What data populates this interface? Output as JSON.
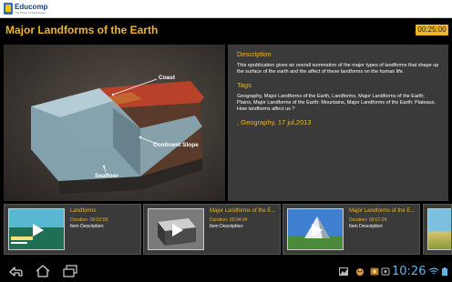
{
  "app": {
    "name": "Educomp",
    "tagline": "The Power of Technology"
  },
  "header": {
    "title": "Major Landforms of the Earth",
    "timer": "00:25:00"
  },
  "figure": {
    "labels": {
      "coast": "Coast",
      "continent_slope": "Continent Slope",
      "seafloor": "Seafloor"
    }
  },
  "details": {
    "description_heading": "Description",
    "description_text": "This epublication gives an overall summation of the major types of landforms that shape up the surface of the earth and the affect of these landforms on the human life.",
    "tags_heading": "Tags",
    "tags_text": "Geography, Major Landforms of the Earth, Landforms, Major Landforms of the Earth: Plains, Major Landforms of the Earth: Mountains, Major Landforms of the Earth: Plateaus, How landforms affect us ?",
    "meta": ", Geography, 17 jul,2013"
  },
  "related": [
    {
      "title": "Landforms",
      "duration_label": "Duration-",
      "duration": "00:02:59",
      "desc_label": "Item Description:"
    },
    {
      "title": "Major Landforms of the E...",
      "duration_label": "Duration-",
      "duration": "00:04:04",
      "desc_label": "Item Description:"
    },
    {
      "title": "Major Landforms of the E...",
      "duration_label": "Duration-",
      "duration": "00:07:24",
      "desc_label": "Item Description:"
    }
  ],
  "status_bar": {
    "time": "10:26"
  },
  "icons": {
    "back": "back-icon",
    "home": "home-icon",
    "recent": "recent-apps-icon"
  }
}
